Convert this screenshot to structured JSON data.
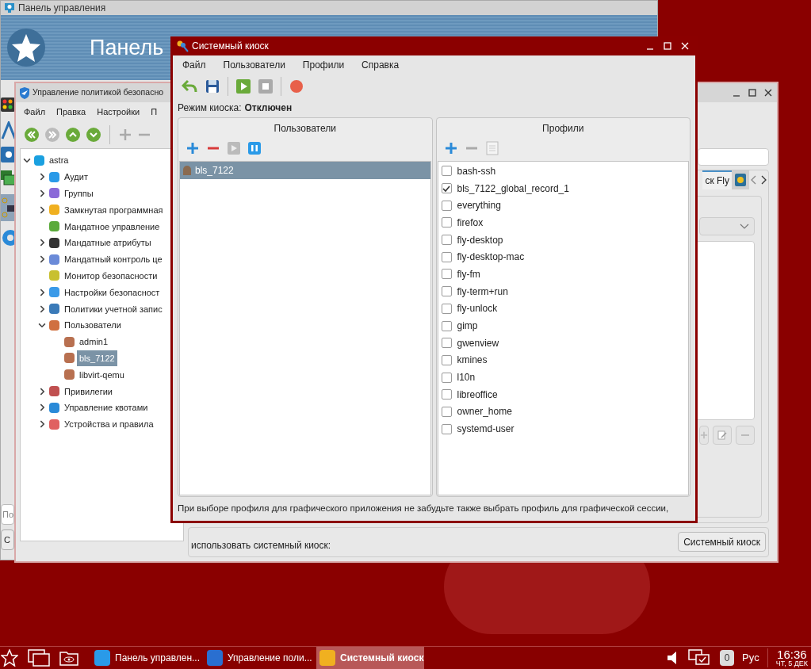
{
  "control_panel": {
    "title": "Панель управления",
    "banner": "Панель",
    "search_placeholder": "По",
    "button": "С"
  },
  "policy_window": {
    "title": "Управление политикой безопасно",
    "menu": [
      "Файл",
      "Правка",
      "Настройки",
      "П"
    ],
    "tree": {
      "label": "astra",
      "expanded": true,
      "selected": false,
      "children": [
        {
          "label": "Аудит",
          "expanded": false,
          "selected": false
        },
        {
          "label": "Группы",
          "expanded": false,
          "selected": false
        },
        {
          "label": "Замкнутая программная",
          "expanded": false,
          "selected": false
        },
        {
          "label": "Мандатное управление",
          "selected": false
        },
        {
          "label": "Мандатные атрибуты",
          "expanded": false,
          "selected": false
        },
        {
          "label": "Мандатный контроль це",
          "expanded": false,
          "selected": false
        },
        {
          "label": "Монитор безопасности",
          "selected": false
        },
        {
          "label": "Настройки безопасност",
          "expanded": false,
          "selected": false
        },
        {
          "label": "Политики учетной запис",
          "expanded": false,
          "selected": false
        },
        {
          "label": "Пользователи",
          "expanded": true,
          "selected": false,
          "children": [
            {
              "label": "admin1",
              "selected": false
            },
            {
              "label": "bls_7122",
              "selected": true
            },
            {
              "label": "libvirt-qemu",
              "selected": false
            }
          ]
        },
        {
          "label": "Привилегии",
          "expanded": false,
          "selected": false
        },
        {
          "label": "Управление квотами",
          "expanded": false,
          "selected": false
        },
        {
          "label": "Устройства и правила",
          "expanded": false,
          "selected": false
        }
      ]
    },
    "tab": "ск Fly",
    "bottom_text": "использовать системный киоск:",
    "kiosk_button": "Системный киоск"
  },
  "kiosk_window": {
    "title": "Системный киоск",
    "menu": [
      "Файл",
      "Пользователи",
      "Профили",
      "Справка"
    ],
    "mode_label": "Режим киоска:",
    "mode_value": "Отключен",
    "users_panel": {
      "title": "Пользователи",
      "users": [
        {
          "name": "bls_7122",
          "selected": true
        }
      ]
    },
    "profiles_panel": {
      "title": "Профили",
      "profiles": [
        {
          "name": "bash-ssh",
          "checked": false
        },
        {
          "name": "bls_7122_global_record_1",
          "checked": true
        },
        {
          "name": "everything",
          "checked": false
        },
        {
          "name": "firefox",
          "checked": false
        },
        {
          "name": "fly-desktop",
          "checked": false
        },
        {
          "name": "fly-desktop-mac",
          "checked": false
        },
        {
          "name": "fly-fm",
          "checked": false
        },
        {
          "name": "fly-term+run",
          "checked": false
        },
        {
          "name": "fly-unlock",
          "checked": false
        },
        {
          "name": "gimp",
          "checked": false
        },
        {
          "name": "gwenview",
          "checked": false
        },
        {
          "name": "kmines",
          "checked": false
        },
        {
          "name": "l10n",
          "checked": false
        },
        {
          "name": "libreoffice",
          "checked": false
        },
        {
          "name": "owner_home",
          "checked": false
        },
        {
          "name": "systemd-user",
          "checked": false
        }
      ]
    },
    "hint": "При выборе профиля для графического приложения не забудьте также выбрать профиль для графической сессии,"
  },
  "taskbar": {
    "tasks": [
      {
        "label": "Панель управлен...",
        "selected": false
      },
      {
        "label": "Управление поли...",
        "selected": false
      },
      {
        "label": "Системный киоск",
        "selected": true
      }
    ],
    "notification_count": "0",
    "language": "Рус",
    "time": "16:36",
    "date": "ЧТ, 5 ДЕК"
  }
}
